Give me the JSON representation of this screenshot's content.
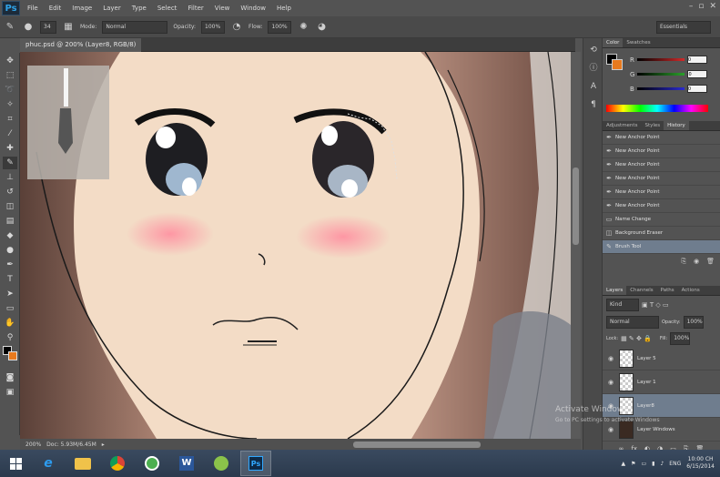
{
  "app": {
    "logo": "Ps",
    "document_tab": "phuc.psd @ 200% (Layer8, RGB/8)"
  },
  "menu": [
    "File",
    "Edit",
    "Image",
    "Layer",
    "Type",
    "Select",
    "Filter",
    "View",
    "Window",
    "Help"
  ],
  "options_bar": {
    "brush_size": "34",
    "mode_label": "Mode:",
    "mode_value": "Normal",
    "opacity_label": "Opacity:",
    "opacity_value": "100%",
    "flow_label": "Flow:",
    "flow_value": "100%",
    "workspace": "Essentials"
  },
  "status_bar": {
    "zoom": "200%",
    "doc": "Doc: 5.93M/6.45M"
  },
  "color_panel": {
    "tabs": [
      "Color",
      "Swatches"
    ],
    "labels": [
      "R",
      "G",
      "B"
    ],
    "values": [
      "0",
      "0",
      "0"
    ],
    "colors": {
      "r": "#d02a2a",
      "g": "#2aa02a",
      "b": "#2a2ad0",
      "fg": "#000000",
      "bg": "#e87a1e"
    }
  },
  "history_panel": {
    "tabs": [
      "Adjustments",
      "Styles",
      "History"
    ],
    "items": [
      {
        "label": "New Anchor Point",
        "icon": "pen-icon"
      },
      {
        "label": "New Anchor Point",
        "icon": "pen-icon"
      },
      {
        "label": "New Anchor Point",
        "icon": "pen-icon"
      },
      {
        "label": "New Anchor Point",
        "icon": "pen-icon"
      },
      {
        "label": "New Anchor Point",
        "icon": "pen-icon"
      },
      {
        "label": "New Anchor Point",
        "icon": "pen-icon"
      },
      {
        "label": "Name Change",
        "icon": "layer-icon"
      },
      {
        "label": "Background Eraser",
        "icon": "eraser-icon"
      },
      {
        "label": "Brush Tool",
        "icon": "brush-icon"
      }
    ]
  },
  "layers_panel": {
    "tabs": [
      "Layers",
      "Channels",
      "Paths",
      "Actions"
    ],
    "filter": "Kind",
    "blend_mode": "Normal",
    "opacity_label": "Opacity:",
    "opacity_value": "100%",
    "lock_label": "Lock:",
    "fill_label": "Fill:",
    "fill_value": "100%",
    "layers": [
      {
        "name": "Layer 5",
        "visible": true
      },
      {
        "name": "Layer 1",
        "visible": true
      },
      {
        "name": "Layer8",
        "visible": true,
        "selected": true
      },
      {
        "name": "Layer Windows",
        "visible": true
      }
    ]
  },
  "watermark": {
    "line1": "Activate Windows",
    "line2": "Go to PC settings to activate Windows"
  },
  "taskbar": {
    "apps": [
      {
        "name": "Internet Explorer",
        "icon": "ie-icon"
      },
      {
        "name": "File Explorer",
        "icon": "folder-icon"
      },
      {
        "name": "Chrome",
        "icon": "chrome-icon"
      },
      {
        "name": "App",
        "icon": "green-app-icon"
      },
      {
        "name": "Word",
        "icon": "word-icon"
      },
      {
        "name": "App",
        "icon": "game-icon"
      },
      {
        "name": "Photoshop",
        "icon": "photoshop-icon",
        "active": true
      }
    ],
    "lang": "ENG",
    "time": "10:00 CH",
    "date": "6/15/2014"
  }
}
